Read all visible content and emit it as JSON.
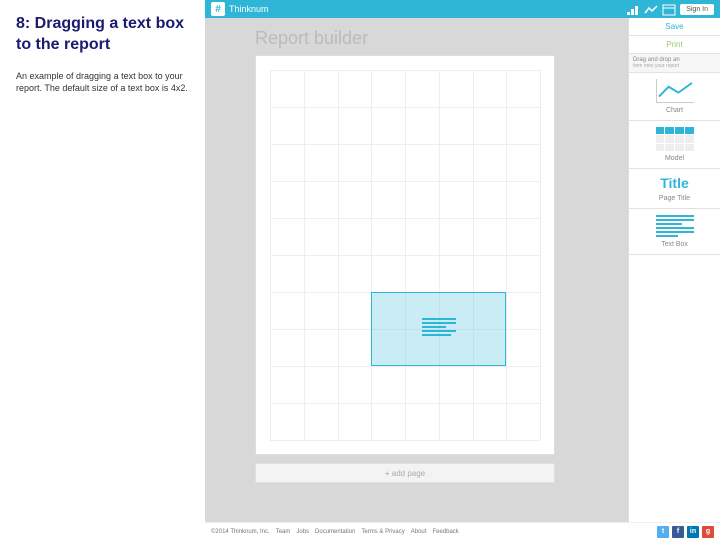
{
  "instruction": {
    "title": "8: Dragging a text box to the report",
    "body": "An example of dragging a text box to your report. The default size of a text box is 4x2."
  },
  "topbar": {
    "brand": "Thinknum",
    "signin": "Sign In"
  },
  "canvas": {
    "title": "Report builder",
    "add_page": "+ add page",
    "drag_selection": {
      "widget_type": "textbox",
      "grid_cols": 4,
      "grid_rows": 2
    }
  },
  "right_panel": {
    "save": "Save",
    "print": "Print",
    "section_header": "Drag and drop an",
    "section_sub": "item onto your report",
    "items": [
      {
        "key": "chart",
        "label": "Chart"
      },
      {
        "key": "model",
        "label": "Model"
      },
      {
        "key": "title",
        "label": "Page Title",
        "glyph_text": "Title"
      },
      {
        "key": "textbox",
        "label": "Text Box"
      }
    ]
  },
  "footer": {
    "links": [
      "©2014 Thinknum, Inc.",
      "Team",
      "Jobs",
      "Documentation",
      "Terms & Privacy",
      "About",
      "Feedback"
    ]
  }
}
